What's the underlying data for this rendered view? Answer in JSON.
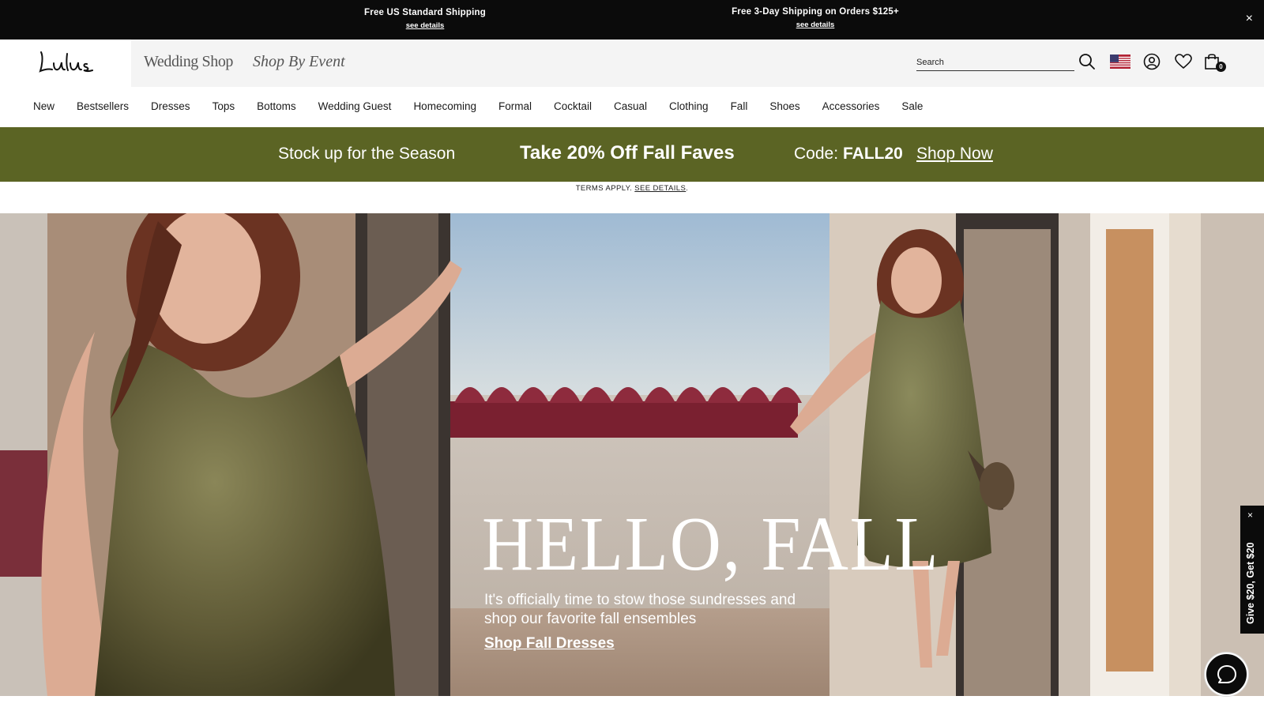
{
  "announcement": {
    "left": {
      "title": "Free US Standard Shipping",
      "link": "see details"
    },
    "right": {
      "title": "Free 3-Day Shipping on Orders $125+",
      "link": "see details"
    },
    "close_label": "×"
  },
  "header": {
    "logo_text": "Lulus",
    "links": [
      "Wedding Shop",
      "Shop By Event"
    ],
    "search": {
      "placeholder": "Search",
      "value": ""
    },
    "icons": [
      "search-icon",
      "us-flag-icon",
      "account-icon",
      "heart-icon",
      "shopping-bag-icon"
    ],
    "bag_count": "0"
  },
  "nav": {
    "items": [
      "New",
      "Bestsellers",
      "Dresses",
      "Tops",
      "Bottoms",
      "Wedding Guest",
      "Homecoming",
      "Formal",
      "Cocktail",
      "Casual",
      "Clothing",
      "Fall",
      "Shoes",
      "Accessories",
      "Sale"
    ]
  },
  "promo": {
    "left": "Stock up for the Season",
    "headline": "Take 20% Off Fall Faves",
    "code_label": "Code:",
    "code": "FALL20",
    "cta": "Shop Now",
    "background": "#5b6424"
  },
  "terms": {
    "text": "TERMS APPLY.",
    "link": "SEE DETAILS",
    "period": "."
  },
  "hero": {
    "title": "HELLO, FALL",
    "subtitle": "It's officially time to stow those sundresses and shop our favorite fall ensembles",
    "cta": "Shop Fall Dresses"
  },
  "side_tab": {
    "text": "Give $20, Get $20",
    "close_label": "×"
  },
  "chat": {
    "icon": "chat-bubble-icon"
  }
}
